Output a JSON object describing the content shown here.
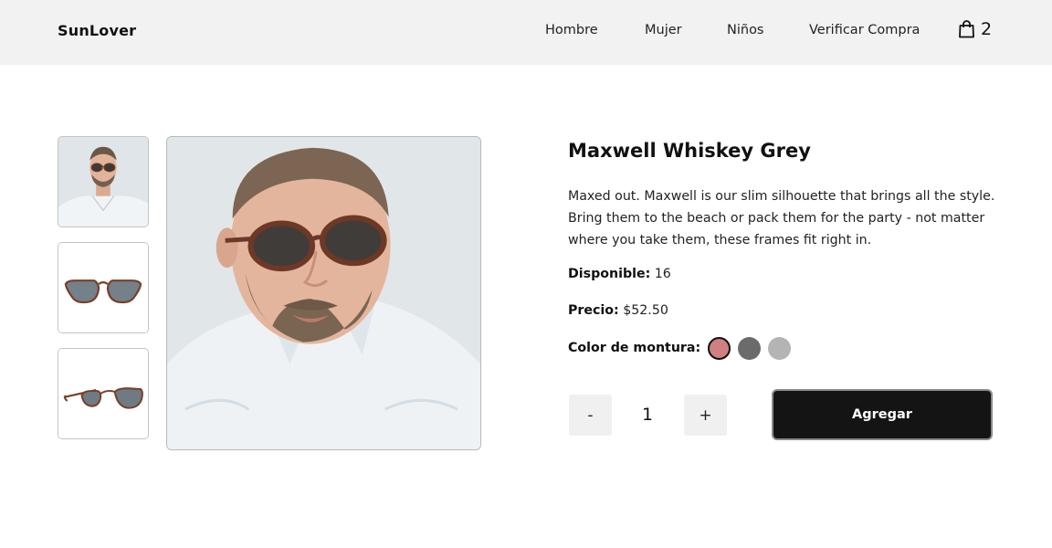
{
  "brand": {
    "name": "SunLover"
  },
  "nav": {
    "items": [
      "Hombre",
      "Mujer",
      "Niños",
      "Verificar Compra"
    ]
  },
  "cart": {
    "count": "2",
    "icon": "shopping-bag-icon"
  },
  "product": {
    "title": "Maxwell Whiskey Grey",
    "description": "Maxed out. Maxwell is our slim silhouette that brings all the style. Bring them to the beach or pack them for the party - not matter where you take them, these frames fit right in.",
    "stock_label": "Disponible:",
    "stock_value": " 16",
    "price_label": "Precio:",
    "price_value": " $52.50",
    "color_label": "Color de montura:",
    "colors": [
      "#d08080",
      "#6b6b6b",
      "#b4b4b4"
    ],
    "selected_color": 0
  },
  "quantity": {
    "minus": "-",
    "value": "1",
    "plus": "+"
  },
  "add_button": {
    "label": "Agregar"
  }
}
